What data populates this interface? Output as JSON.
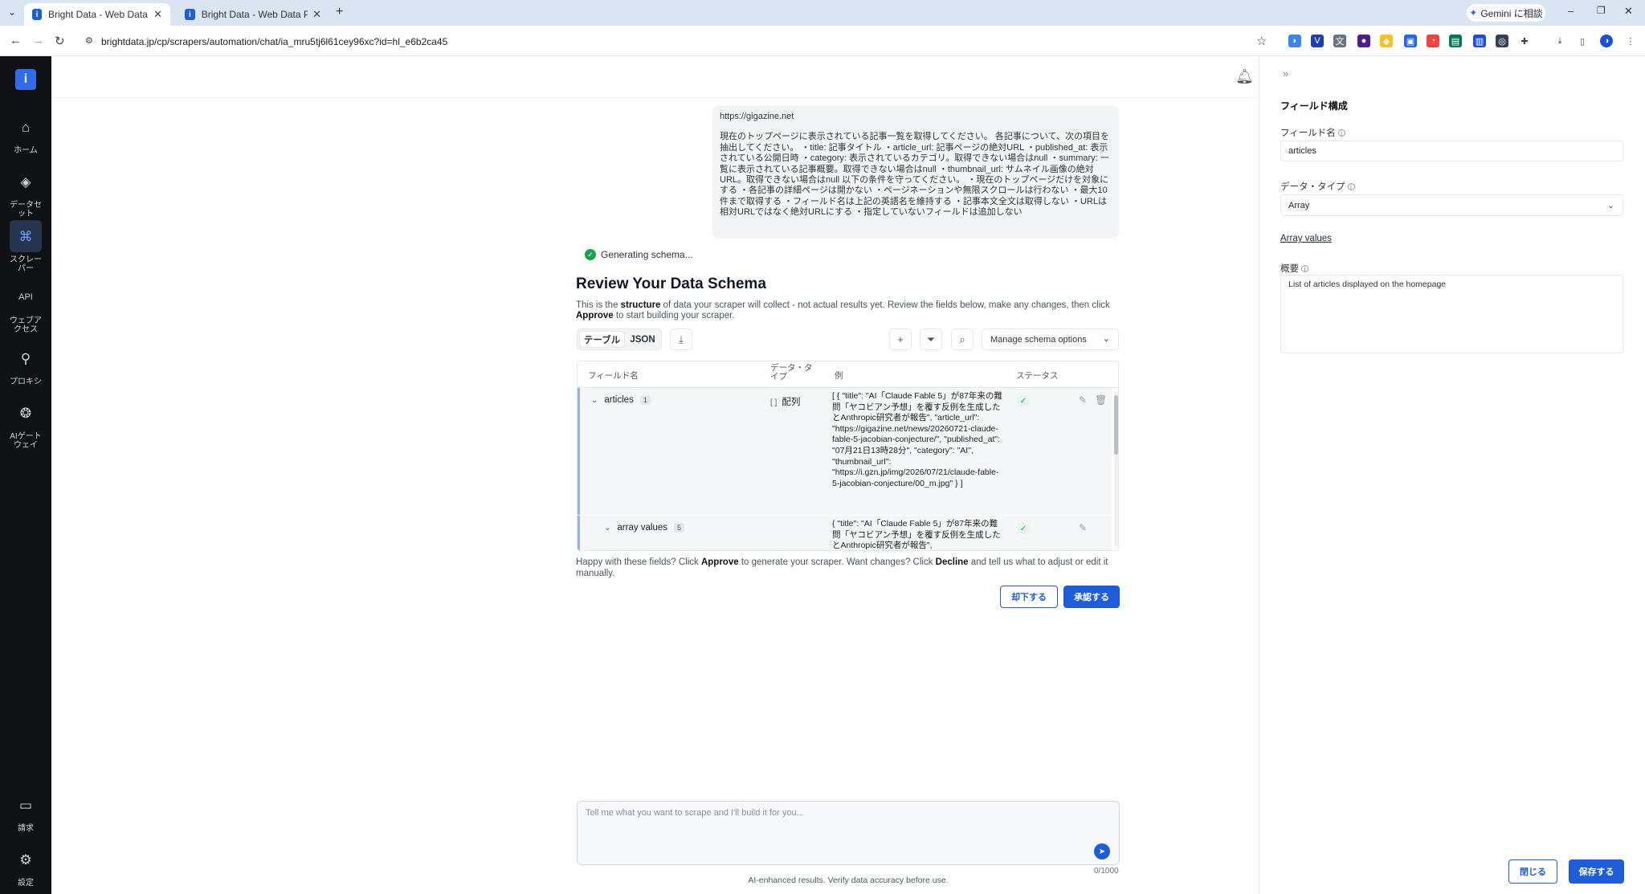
{
  "browser": {
    "tabs": [
      {
        "title": "Bright Data - Web Data Platform",
        "active": true
      },
      {
        "title": "Bright Data - Web Data Platform",
        "active": false
      }
    ],
    "url": "brightdata.jp/cp/scrapers/automation/chat/ia_mru5tj6l61cey96xc?id=hl_e6b2ca45",
    "gemini_label": "Gemini に相談"
  },
  "sidebar": {
    "logo": "i",
    "items": [
      {
        "label": "ホーム",
        "icon": "home-icon"
      },
      {
        "label": "データセット",
        "icon": "layers-icon"
      },
      {
        "label": "スクレーパー",
        "icon": "scraper-icon",
        "active": true
      },
      {
        "label": "ウェブアクセス",
        "icon": "api-icon",
        "badge": "API"
      },
      {
        "label": "プロキシ",
        "icon": "location-pin-icon"
      },
      {
        "label": "AIゲートウェイ",
        "icon": "brain-icon"
      },
      {
        "label": "請求",
        "icon": "billing-icon"
      },
      {
        "label": "設定",
        "icon": "gear-icon"
      }
    ]
  },
  "chat": {
    "user_url": "https://gigazine.net",
    "user_message": "現在のトップページに表示されている記事一覧を取得してください。 各記事について、次の項目を抽出してください。 ・title: 記事タイトル ・article_url: 記事ページの絶対URL ・published_at: 表示されている公開日時 ・category: 表示されているカテゴリ。取得できない場合はnull ・summary: 一覧に表示されている記事概要。取得できない場合はnull ・thumbnail_url: サムネイル画像の絶対URL。取得できない場合はnull 以下の条件を守ってください。 ・現在のトップページだけを対象にする ・各記事の詳細ページは開かない ・ページネーションや無限スクロールは行わない ・最大10件まで取得する ・フィールド名は上記の英語名を維持する ・記事本文全文は取得しない ・URLは相対URLではなく絶対URLにする ・指定していないフィールドは追加しない",
    "status": "Generating schema..."
  },
  "review": {
    "title": "Review Your Data Schema",
    "desc_1": "This is the ",
    "desc_bold_1": "structure",
    "desc_2": " of data your scraper will collect - not actual results yet. Review the fields below, make any changes, then click ",
    "desc_bold_2": "Approve",
    "desc_3": " to start building your scraper.",
    "tabs": [
      "テーブル",
      "JSON"
    ],
    "manage_label": "Manage schema options",
    "columns": {
      "field": "フィールド名",
      "type": "データ・タイプ",
      "example": "例",
      "status": "ステータス"
    },
    "rows": [
      {
        "name": "articles",
        "count": "1",
        "type": "配列",
        "example": "[ { \"title\": \"AI「Claude Fable 5」が87年来の難問「ヤコビアン予想」を覆す反例を生成したとAnthropic研究者が報告\", \"article_url\": \"https://gigazine.net/news/20260721-claude-fable-5-jacobian-conjecture/\", \"published_at\": \"07月21日13時28分\", \"category\": \"AI\", \"thumbnail_url\": \"https://i.gzn.jp/img/2026/07/21/claude-fable-5-jacobian-conjecture/00_m.jpg\" } ]"
      },
      {
        "name": "array values",
        "count": "5",
        "type": "",
        "example": "{ \"title\": \"AI「Claude Fable 5」が87年来の難問「ヤコビアン予想」を覆す反例を生成したとAnthropic研究者が報告\","
      }
    ],
    "happy_1": "Happy with these fields? Click ",
    "happy_bold_1": "Approve",
    "happy_2": " to generate your scraper. Want changes? Click ",
    "happy_bold_2": "Decline",
    "happy_3": " and tell us what to adjust or edit it manually.",
    "decline_label": "却下する",
    "approve_label": "承認する"
  },
  "composer": {
    "placeholder": "Tell me what you want to scrape and I'll build it for you...",
    "counter": "0/1000",
    "disclaimer": "AI-enhanced results. Verify data accuracy before use."
  },
  "panel": {
    "title": "フィールド構成",
    "field_name_label": "フィールド名",
    "field_name_value": "articles",
    "data_type_label": "データ・タイプ",
    "data_type_value": "Array",
    "array_values_link": "Array values",
    "summary_label": "概要",
    "summary_value": "List of articles displayed on the homepage",
    "close_label": "閉じる",
    "save_label": "保存する"
  },
  "colors": {
    "primary": "#1d5dd8",
    "sidebar_bg": "#0f1115",
    "success": "#16a34a"
  }
}
